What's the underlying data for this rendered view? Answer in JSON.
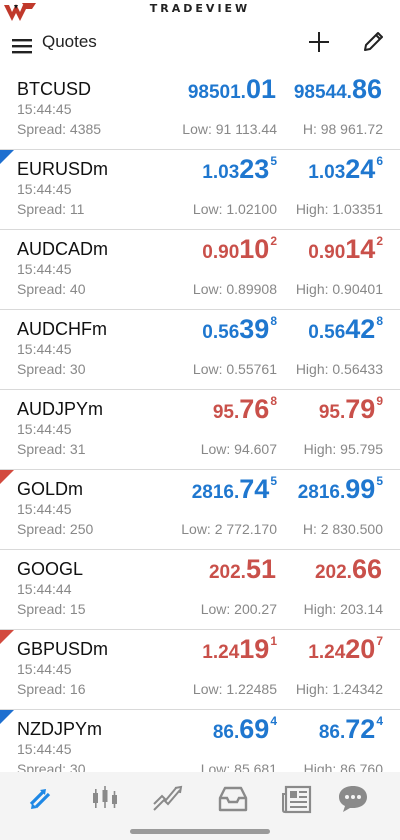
{
  "brand": {
    "name": "TRADEVIEW"
  },
  "header": {
    "title": "Quotes",
    "menu_icon": "menu-icon",
    "add_icon": "plus-icon",
    "edit_icon": "pencil-icon"
  },
  "colors": {
    "up": "#1f77cf",
    "down": "#c9504a",
    "marker_blue": "#1e6fd0",
    "marker_red": "#d34a3e",
    "tab_active": "#1e88e5",
    "tab_inactive": "#8a8a8a"
  },
  "quotes": [
    {
      "symbol": "BTCUSD",
      "time": "15:44:45",
      "spread": "Spread: 4385",
      "low": "Low: 91 113.44",
      "high": "H: 98 961.72",
      "bid": {
        "base": "98501.",
        "big": "01",
        "sup": ""
      },
      "ask": {
        "base": "98544.",
        "big": "86",
        "sup": ""
      },
      "direction": "up",
      "marker": "none"
    },
    {
      "symbol": "EURUSDm",
      "time": "15:44:45",
      "spread": "Spread: 11",
      "low": "Low: 1.02100",
      "high": "High: 1.03351",
      "bid": {
        "base": "1.03",
        "big": "23",
        "sup": "5"
      },
      "ask": {
        "base": "1.03",
        "big": "24",
        "sup": "6"
      },
      "direction": "up",
      "marker": "blue"
    },
    {
      "symbol": "AUDCADm",
      "time": "15:44:45",
      "spread": "Spread: 40",
      "low": "Low: 0.89908",
      "high": "High: 0.90401",
      "bid": {
        "base": "0.90",
        "big": "10",
        "sup": "2"
      },
      "ask": {
        "base": "0.90",
        "big": "14",
        "sup": "2"
      },
      "direction": "down",
      "marker": "none"
    },
    {
      "symbol": "AUDCHFm",
      "time": "15:44:45",
      "spread": "Spread: 30",
      "low": "Low: 0.55761",
      "high": "High: 0.56433",
      "bid": {
        "base": "0.56",
        "big": "39",
        "sup": "8"
      },
      "ask": {
        "base": "0.56",
        "big": "42",
        "sup": "8"
      },
      "direction": "up",
      "marker": "none"
    },
    {
      "symbol": "AUDJPYm",
      "time": "15:44:45",
      "spread": "Spread: 31",
      "low": "Low: 94.607",
      "high": "High: 95.795",
      "bid": {
        "base": "95.",
        "big": "76",
        "sup": "8"
      },
      "ask": {
        "base": "95.",
        "big": "79",
        "sup": "9"
      },
      "direction": "down",
      "marker": "none"
    },
    {
      "symbol": "GOLDm",
      "time": "15:44:45",
      "spread": "Spread: 250",
      "low": "Low: 2 772.170",
      "high": "H: 2 830.500",
      "bid": {
        "base": "2816.",
        "big": "74",
        "sup": "5"
      },
      "ask": {
        "base": "2816.",
        "big": "99",
        "sup": "5"
      },
      "direction": "up",
      "marker": "red"
    },
    {
      "symbol": "GOOGL",
      "time": "15:44:44",
      "spread": "Spread: 15",
      "low": "Low: 200.27",
      "high": "High: 203.14",
      "bid": {
        "base": "202.",
        "big": "51",
        "sup": ""
      },
      "ask": {
        "base": "202.",
        "big": "66",
        "sup": ""
      },
      "direction": "down",
      "marker": "none"
    },
    {
      "symbol": "GBPUSDm",
      "time": "15:44:45",
      "spread": "Spread: 16",
      "low": "Low: 1.22485",
      "high": "High: 1.24342",
      "bid": {
        "base": "1.24",
        "big": "19",
        "sup": "1"
      },
      "ask": {
        "base": "1.24",
        "big": "20",
        "sup": "7"
      },
      "direction": "down",
      "marker": "red"
    },
    {
      "symbol": "NZDJPYm",
      "time": "15:44:45",
      "spread": "Spread: 30",
      "low": "Low: 85.681",
      "high": "High: 86.760",
      "bid": {
        "base": "86.",
        "big": "69",
        "sup": "4"
      },
      "ask": {
        "base": "86.",
        "big": "72",
        "sup": "4"
      },
      "direction": "up",
      "marker": "blue"
    }
  ],
  "tabs": [
    {
      "name": "quotes-tab",
      "icon": "arrows-icon",
      "active": true
    },
    {
      "name": "chart-tab",
      "icon": "candlestick-icon",
      "active": false
    },
    {
      "name": "trade-tab",
      "icon": "trend-icon",
      "active": false
    },
    {
      "name": "history-tab",
      "icon": "inbox-icon",
      "active": false
    },
    {
      "name": "news-tab",
      "icon": "newspaper-icon",
      "active": false
    },
    {
      "name": "messages-tab",
      "icon": "chat-icon",
      "active": false
    }
  ]
}
